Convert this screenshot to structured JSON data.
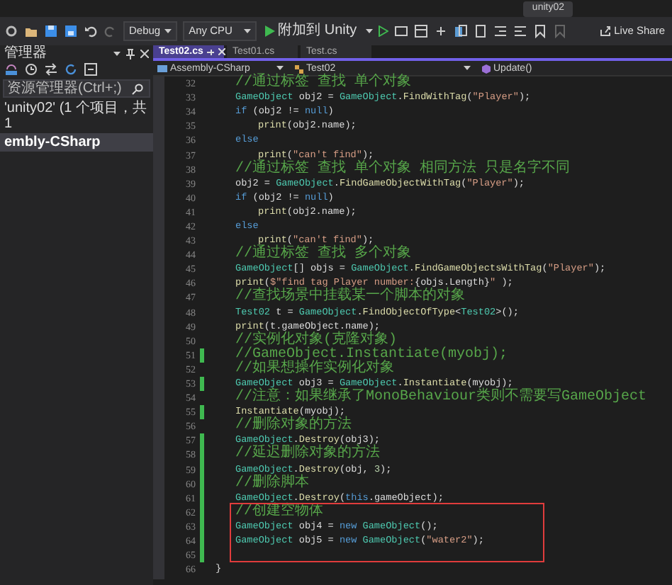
{
  "window": {
    "title": "unity02"
  },
  "toolbar": {
    "configuration": "Debug",
    "platform": "Any CPU",
    "run_button": "附加到 Unity",
    "live_share": "Live Share"
  },
  "solution_explorer": {
    "title": "管理器",
    "search": {
      "placeholder": "资源管理器(Ctrl+;)"
    },
    "tree": [
      {
        "label": "'unity02' (1 个项目，共 1",
        "selected": false,
        "children": [
          {
            "label": "embly-CSharp",
            "selected": true
          }
        ]
      }
    ]
  },
  "tabs": [
    {
      "label": "Test02.cs",
      "selected": true
    },
    {
      "label": "Test01.cs",
      "selected": false
    },
    {
      "label": "Test.cs",
      "selected": false
    }
  ],
  "navigation": {
    "project": "Assembly-CSharp",
    "class": "Test02",
    "member": "Update()"
  },
  "editor": {
    "lines": [
      {
        "number": "32",
        "kind": "body",
        "changed": false,
        "highlighted": false,
        "tokens": [
          {
            "kind": "comment",
            "text": "//通过标签 查找 单个对象"
          }
        ]
      },
      {
        "number": "33",
        "kind": "body",
        "changed": false,
        "highlighted": false,
        "tokens": [
          {
            "kind": "type",
            "text": "GameObject"
          },
          {
            "kind": "plain",
            "text": " obj2 = "
          },
          {
            "kind": "type",
            "text": "GameObject"
          },
          {
            "kind": "plain",
            "text": "."
          },
          {
            "kind": "method",
            "text": "FindWithTag"
          },
          {
            "kind": "plain",
            "text": "("
          },
          {
            "kind": "string",
            "text": "\"Player\""
          },
          {
            "kind": "plain",
            "text": ");"
          }
        ]
      },
      {
        "number": "34",
        "kind": "body",
        "changed": false,
        "highlighted": false,
        "tokens": [
          {
            "kind": "keyword",
            "text": "if"
          },
          {
            "kind": "plain",
            "text": " (obj2 != "
          },
          {
            "kind": "keyword",
            "text": "null"
          },
          {
            "kind": "plain",
            "text": ")"
          }
        ]
      },
      {
        "number": "35",
        "kind": "nested",
        "changed": false,
        "highlighted": false,
        "tokens": [
          {
            "kind": "method",
            "text": "print"
          },
          {
            "kind": "plain",
            "text": "(obj2.name);"
          }
        ]
      },
      {
        "number": "36",
        "kind": "body",
        "changed": false,
        "highlighted": false,
        "tokens": [
          {
            "kind": "keyword",
            "text": "else"
          }
        ]
      },
      {
        "number": "37",
        "kind": "nested",
        "changed": false,
        "highlighted": false,
        "tokens": [
          {
            "kind": "method",
            "text": "print"
          },
          {
            "kind": "plain",
            "text": "("
          },
          {
            "kind": "string",
            "text": "\"can't find\""
          },
          {
            "kind": "plain",
            "text": ");"
          }
        ]
      },
      {
        "number": "38",
        "kind": "body",
        "changed": false,
        "highlighted": false,
        "tokens": [
          {
            "kind": "comment",
            "text": "//通过标签 查找 单个对象 相同方法 只是名字不同"
          }
        ]
      },
      {
        "number": "39",
        "kind": "body",
        "changed": false,
        "highlighted": false,
        "tokens": [
          {
            "kind": "plain",
            "text": "obj2 = "
          },
          {
            "kind": "type",
            "text": "GameObject"
          },
          {
            "kind": "plain",
            "text": "."
          },
          {
            "kind": "method",
            "text": "FindGameObjectWithTag"
          },
          {
            "kind": "plain",
            "text": "("
          },
          {
            "kind": "string",
            "text": "\"Player\""
          },
          {
            "kind": "plain",
            "text": ");"
          }
        ]
      },
      {
        "number": "40",
        "kind": "body",
        "changed": false,
        "highlighted": false,
        "tokens": [
          {
            "kind": "keyword",
            "text": "if"
          },
          {
            "kind": "plain",
            "text": " (obj2 != "
          },
          {
            "kind": "keyword",
            "text": "null"
          },
          {
            "kind": "plain",
            "text": ")"
          }
        ]
      },
      {
        "number": "41",
        "kind": "nested",
        "changed": false,
        "highlighted": false,
        "tokens": [
          {
            "kind": "method",
            "text": "print"
          },
          {
            "kind": "plain",
            "text": "(obj2.name);"
          }
        ]
      },
      {
        "number": "42",
        "kind": "body",
        "changed": false,
        "highlighted": false,
        "tokens": [
          {
            "kind": "keyword",
            "text": "else"
          }
        ]
      },
      {
        "number": "43",
        "kind": "nested",
        "changed": false,
        "highlighted": false,
        "tokens": [
          {
            "kind": "method",
            "text": "print"
          },
          {
            "kind": "plain",
            "text": "("
          },
          {
            "kind": "string",
            "text": "\"can't find\""
          },
          {
            "kind": "plain",
            "text": ");"
          }
        ]
      },
      {
        "number": "44",
        "kind": "body",
        "changed": false,
        "highlighted": false,
        "tokens": [
          {
            "kind": "comment",
            "text": "//通过标签 查找 多个对象"
          }
        ]
      },
      {
        "number": "45",
        "kind": "body",
        "changed": false,
        "highlighted": false,
        "tokens": [
          {
            "kind": "type",
            "text": "GameObject"
          },
          {
            "kind": "plain",
            "text": "[] objs = "
          },
          {
            "kind": "type",
            "text": "GameObject"
          },
          {
            "kind": "plain",
            "text": "."
          },
          {
            "kind": "method",
            "text": "FindGameObjectsWithTag"
          },
          {
            "kind": "plain",
            "text": "("
          },
          {
            "kind": "string",
            "text": "\"Player\""
          },
          {
            "kind": "plain",
            "text": ");"
          }
        ]
      },
      {
        "number": "46",
        "kind": "body",
        "changed": false,
        "highlighted": false,
        "tokens": [
          {
            "kind": "method",
            "text": "print"
          },
          {
            "kind": "plain",
            "text": "("
          },
          {
            "kind": "string",
            "text": "$\"find tag Player number:"
          },
          {
            "kind": "plain",
            "text": "{objs.Length}"
          },
          {
            "kind": "string",
            "text": "\""
          },
          {
            "kind": "plain",
            "text": " );"
          }
        ]
      },
      {
        "number": "47",
        "kind": "body",
        "changed": false,
        "highlighted": false,
        "tokens": [
          {
            "kind": "comment",
            "text": "//查找场景中挂载某一个脚本的对象"
          }
        ]
      },
      {
        "number": "48",
        "kind": "body",
        "changed": false,
        "highlighted": false,
        "tokens": [
          {
            "kind": "type",
            "text": "Test02"
          },
          {
            "kind": "plain",
            "text": " t = "
          },
          {
            "kind": "type",
            "text": "GameObject"
          },
          {
            "kind": "plain",
            "text": "."
          },
          {
            "kind": "method",
            "text": "FindObjectOfType"
          },
          {
            "kind": "plain",
            "text": "<"
          },
          {
            "kind": "type",
            "text": "Test02"
          },
          {
            "kind": "plain",
            "text": ">();"
          }
        ]
      },
      {
        "number": "49",
        "kind": "body",
        "changed": false,
        "highlighted": false,
        "tokens": [
          {
            "kind": "method",
            "text": "print"
          },
          {
            "kind": "plain",
            "text": "(t.gameObject.name);"
          }
        ]
      },
      {
        "number": "50",
        "kind": "body",
        "changed": false,
        "highlighted": false,
        "tokens": [
          {
            "kind": "comment",
            "text": "//实例化对象(克隆对象)"
          }
        ]
      },
      {
        "number": "51",
        "kind": "body",
        "changed": true,
        "highlighted": false,
        "tokens": [
          {
            "kind": "comment",
            "text": "//GameObject.Instantiate(myobj);"
          }
        ]
      },
      {
        "number": "52",
        "kind": "body",
        "changed": false,
        "highlighted": false,
        "tokens": [
          {
            "kind": "comment",
            "text": "//如果想操作实例化对象"
          }
        ]
      },
      {
        "number": "53",
        "kind": "body",
        "changed": true,
        "highlighted": false,
        "tokens": [
          {
            "kind": "type",
            "text": "GameObject"
          },
          {
            "kind": "plain",
            "text": " obj3 = "
          },
          {
            "kind": "type",
            "text": "GameObject"
          },
          {
            "kind": "plain",
            "text": "."
          },
          {
            "kind": "method",
            "text": "Instantiate"
          },
          {
            "kind": "plain",
            "text": "(myobj);"
          }
        ]
      },
      {
        "number": "54",
        "kind": "body",
        "changed": false,
        "highlighted": false,
        "tokens": [
          {
            "kind": "comment",
            "text": "//注意：如果继承了MonoBehaviour类则不需要写GameObject"
          }
        ]
      },
      {
        "number": "55",
        "kind": "body",
        "changed": true,
        "highlighted": false,
        "tokens": [
          {
            "kind": "method",
            "text": "Instantiate"
          },
          {
            "kind": "plain",
            "text": "(myobj);"
          }
        ]
      },
      {
        "number": "56",
        "kind": "body",
        "changed": false,
        "highlighted": false,
        "tokens": [
          {
            "kind": "comment",
            "text": "//删除对象的方法"
          }
        ]
      },
      {
        "number": "57",
        "kind": "body",
        "changed": true,
        "highlighted": false,
        "tokens": [
          {
            "kind": "type",
            "text": "GameObject"
          },
          {
            "kind": "plain",
            "text": "."
          },
          {
            "kind": "method",
            "text": "Destroy"
          },
          {
            "kind": "plain",
            "text": "(obj3);"
          }
        ]
      },
      {
        "number": "58",
        "kind": "body",
        "changed": true,
        "highlighted": false,
        "tokens": [
          {
            "kind": "comment",
            "text": "//延迟删除对象的方法"
          }
        ]
      },
      {
        "number": "59",
        "kind": "body",
        "changed": true,
        "highlighted": false,
        "tokens": [
          {
            "kind": "type",
            "text": "GameObject"
          },
          {
            "kind": "plain",
            "text": "."
          },
          {
            "kind": "method",
            "text": "Destroy"
          },
          {
            "kind": "plain",
            "text": "(obj, "
          },
          {
            "kind": "number",
            "text": "3"
          },
          {
            "kind": "plain",
            "text": ");"
          }
        ]
      },
      {
        "number": "60",
        "kind": "body",
        "changed": true,
        "highlighted": false,
        "tokens": [
          {
            "kind": "comment",
            "text": "//删除脚本"
          }
        ]
      },
      {
        "number": "61",
        "kind": "body",
        "changed": true,
        "highlighted": false,
        "tokens": [
          {
            "kind": "type",
            "text": "GameObject"
          },
          {
            "kind": "plain",
            "text": "."
          },
          {
            "kind": "method",
            "text": "Destroy"
          },
          {
            "kind": "plain",
            "text": "("
          },
          {
            "kind": "keyword",
            "text": "this"
          },
          {
            "kind": "plain",
            "text": ".gameObject);"
          }
        ]
      },
      {
        "number": "62",
        "kind": "body",
        "changed": true,
        "highlighted": true,
        "tokens": [
          {
            "kind": "comment",
            "text": "//创建空物体"
          }
        ]
      },
      {
        "number": "63",
        "kind": "body",
        "changed": true,
        "highlighted": true,
        "tokens": [
          {
            "kind": "type",
            "text": "GameObject"
          },
          {
            "kind": "plain",
            "text": " obj4 = "
          },
          {
            "kind": "keyword",
            "text": "new"
          },
          {
            "kind": "type",
            "text": " GameObject"
          },
          {
            "kind": "plain",
            "text": "();"
          }
        ]
      },
      {
        "number": "64",
        "kind": "body",
        "changed": true,
        "highlighted": true,
        "tokens": [
          {
            "kind": "type",
            "text": "GameObject"
          },
          {
            "kind": "plain",
            "text": " obj5 = "
          },
          {
            "kind": "keyword",
            "text": "new"
          },
          {
            "kind": "type",
            "text": " GameObject"
          },
          {
            "kind": "plain",
            "text": "("
          },
          {
            "kind": "string",
            "text": "\"water2\""
          },
          {
            "kind": "plain",
            "text": ");"
          }
        ]
      },
      {
        "number": "65",
        "changed": true,
        "highlighted": true
      },
      {
        "number": "66",
        "kind": "close",
        "changed": false,
        "highlighted": false,
        "tokens": [
          {
            "kind": "plain",
            "text": "}"
          }
        ]
      }
    ]
  }
}
